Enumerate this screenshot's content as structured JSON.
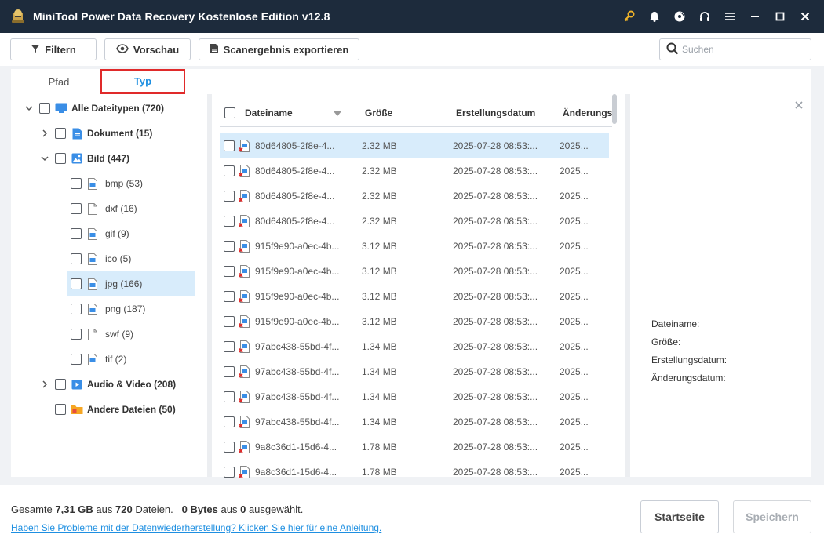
{
  "app": {
    "title": "MiniTool Power Data Recovery Kostenlose Edition v12.8"
  },
  "toolbar": {
    "filter_label": "Filtern",
    "preview_label": "Vorschau",
    "export_label": "Scanergebnis exportieren",
    "search_placeholder": "Suchen"
  },
  "tabs": {
    "pfad": "Pfad",
    "typ": "Typ"
  },
  "tree": {
    "all": "Alle Dateitypen (720)",
    "dokument": "Dokument (15)",
    "bild": "Bild (447)",
    "subtypes": [
      "bmp (53)",
      "dxf (16)",
      "gif (9)",
      "ico (5)",
      "jpg (166)",
      "png (187)",
      "swf (9)",
      "tif (2)"
    ],
    "audio_video": "Audio & Video (208)",
    "andere": "Andere Dateien (50)"
  },
  "table": {
    "headers": {
      "name": "Dateiname",
      "size": "Größe",
      "created": "Erstellungsdatum",
      "modified": "Änderungs"
    },
    "rows": [
      {
        "name": "80d64805-2f8e-4...",
        "size": "2.32 MB",
        "created": "2025-07-28 08:53:...",
        "modified": "2025..."
      },
      {
        "name": "80d64805-2f8e-4...",
        "size": "2.32 MB",
        "created": "2025-07-28 08:53:...",
        "modified": "2025..."
      },
      {
        "name": "80d64805-2f8e-4...",
        "size": "2.32 MB",
        "created": "2025-07-28 08:53:...",
        "modified": "2025..."
      },
      {
        "name": "80d64805-2f8e-4...",
        "size": "2.32 MB",
        "created": "2025-07-28 08:53:...",
        "modified": "2025..."
      },
      {
        "name": "915f9e90-a0ec-4b...",
        "size": "3.12 MB",
        "created": "2025-07-28 08:53:...",
        "modified": "2025..."
      },
      {
        "name": "915f9e90-a0ec-4b...",
        "size": "3.12 MB",
        "created": "2025-07-28 08:53:...",
        "modified": "2025..."
      },
      {
        "name": "915f9e90-a0ec-4b...",
        "size": "3.12 MB",
        "created": "2025-07-28 08:53:...",
        "modified": "2025..."
      },
      {
        "name": "915f9e90-a0ec-4b...",
        "size": "3.12 MB",
        "created": "2025-07-28 08:53:...",
        "modified": "2025..."
      },
      {
        "name": "97abc438-55bd-4f...",
        "size": "1.34 MB",
        "created": "2025-07-28 08:53:...",
        "modified": "2025..."
      },
      {
        "name": "97abc438-55bd-4f...",
        "size": "1.34 MB",
        "created": "2025-07-28 08:53:...",
        "modified": "2025..."
      },
      {
        "name": "97abc438-55bd-4f...",
        "size": "1.34 MB",
        "created": "2025-07-28 08:53:...",
        "modified": "2025..."
      },
      {
        "name": "97abc438-55bd-4f...",
        "size": "1.34 MB",
        "created": "2025-07-28 08:53:...",
        "modified": "2025..."
      },
      {
        "name": "9a8c36d1-15d6-4...",
        "size": "1.78 MB",
        "created": "2025-07-28 08:53:...",
        "modified": "2025..."
      },
      {
        "name": "9a8c36d1-15d6-4...",
        "size": "1.78 MB",
        "created": "2025-07-28 08:53:...",
        "modified": "2025..."
      }
    ]
  },
  "preview": {
    "name_label": "Dateiname:",
    "size_label": "Größe:",
    "created_label": "Erstellungsdatum:",
    "modified_label": "Änderungsdatum:"
  },
  "footer": {
    "total_prefix": "Gesamte",
    "total_size": "7,31 GB",
    "total_mid": "aus",
    "total_count": "720",
    "total_suffix": "Dateien.",
    "selected_size": "0 Bytes",
    "selected_mid": "aus",
    "selected_count": "0",
    "selected_suffix": "ausgewählt.",
    "help_link": "Haben Sie Probleme mit der Datenwiederherstellung? Klicken Sie hier für eine Anleitung.",
    "home_button": "Startseite",
    "save_button": "Speichern"
  },
  "colors": {
    "titlebar": "#1d2b3c",
    "accent": "#1e8fe1",
    "highlight_border": "#e02a2a",
    "selection": "#d8ecfb"
  }
}
